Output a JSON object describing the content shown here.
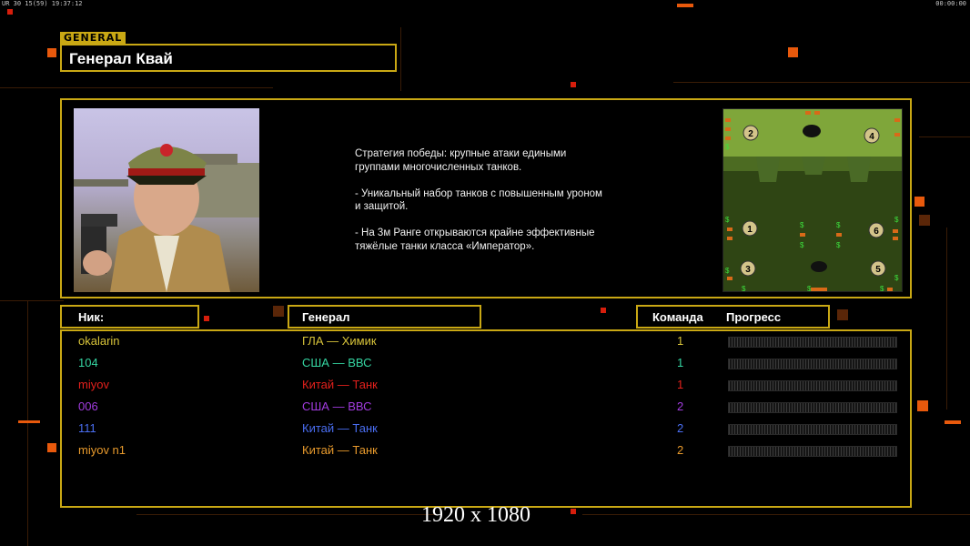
{
  "topbar": {
    "left": "UR 30 15(59) 19:37:12",
    "right": "00:00:00"
  },
  "general": {
    "tag": "GENERAL",
    "name": "Генерал Квай",
    "strategy": "Стратегия победы: крупные атаки едиными\n группами многочисленных танков.\n\n- Уникальный набор танков с повышенным уроном\n и защитой.\n\n- На 3м Ранге открываются крайне эффективные\n тяжёлые танки класса «Император»."
  },
  "minimap": {
    "slots": [
      "2",
      "4",
      "1",
      "6",
      "3",
      "5"
    ]
  },
  "headers": {
    "nick": "Ник:",
    "general": "Генерал",
    "team": "Команда",
    "progress": "Прогресс"
  },
  "players": [
    {
      "nick": "okalarin",
      "general": "ГЛА — Химик",
      "team": "1",
      "color": "#d8c43a",
      "progress": 0
    },
    {
      "nick": "104",
      "general": "США — ВВС",
      "team": "1",
      "color": "#35d6a2",
      "progress": 0
    },
    {
      "nick": "miyov",
      "general": "Китай — Танк",
      "team": "1",
      "color": "#e4201c",
      "progress": 0
    },
    {
      "nick": "006",
      "general": "США — ВВС",
      "team": "2",
      "color": "#a23ce0",
      "progress": 0
    },
    {
      "nick": "111",
      "general": "Китай — Танк",
      "team": "2",
      "color": "#4a6ef2",
      "progress": 0
    },
    {
      "nick": "miyov n1",
      "general": "Китай — Танк",
      "team": "2",
      "color": "#e89a2c",
      "progress": 0
    }
  ],
  "watermark": "1920 x 1080"
}
